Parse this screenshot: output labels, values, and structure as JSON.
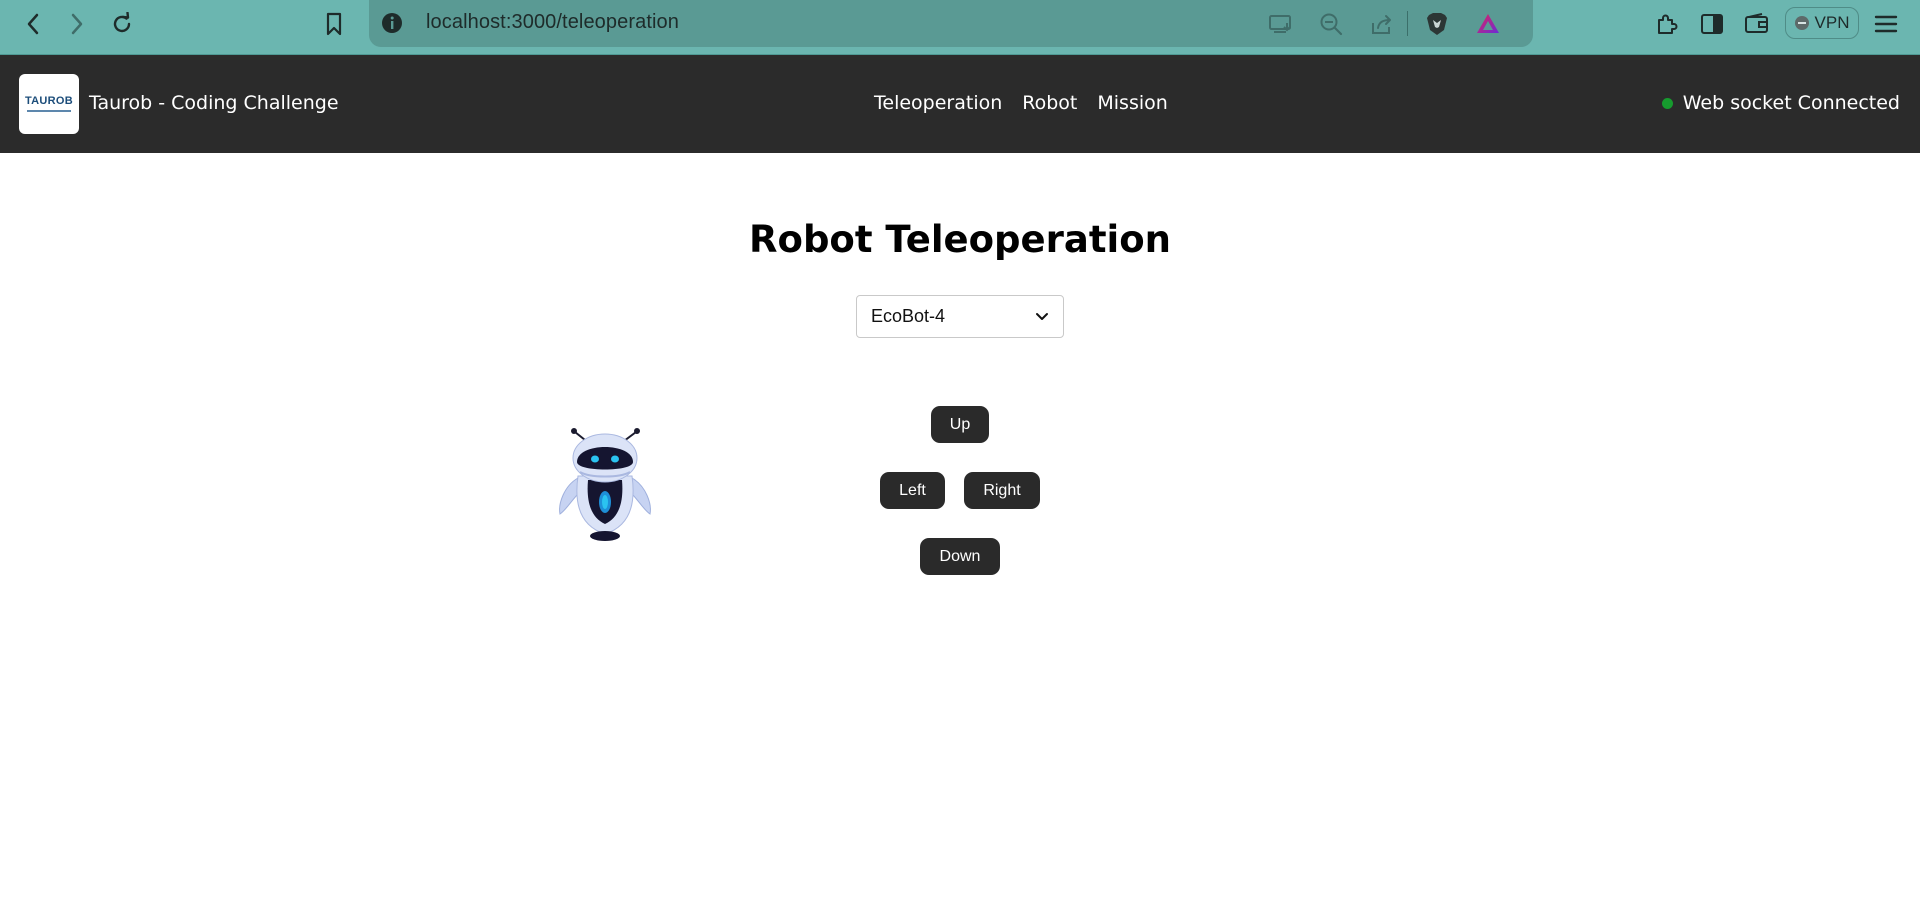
{
  "browser": {
    "url": "localhost:3000/teleoperation",
    "vpn_label": "VPN"
  },
  "app": {
    "title": "Taurob - Coding Challenge",
    "logo_text": "TAUROB",
    "nav": [
      {
        "label": "Teleoperation"
      },
      {
        "label": "Robot"
      },
      {
        "label": "Mission"
      }
    ],
    "ws_status": "Web socket Connected",
    "ws_color": "#169b2e",
    "header_bg": "#2b2b2b"
  },
  "page": {
    "title": "Robot Teleoperation",
    "selected_robot": "EcoBot-4"
  },
  "controls": {
    "up": "Up",
    "left": "Left",
    "right": "Right",
    "down": "Down"
  }
}
